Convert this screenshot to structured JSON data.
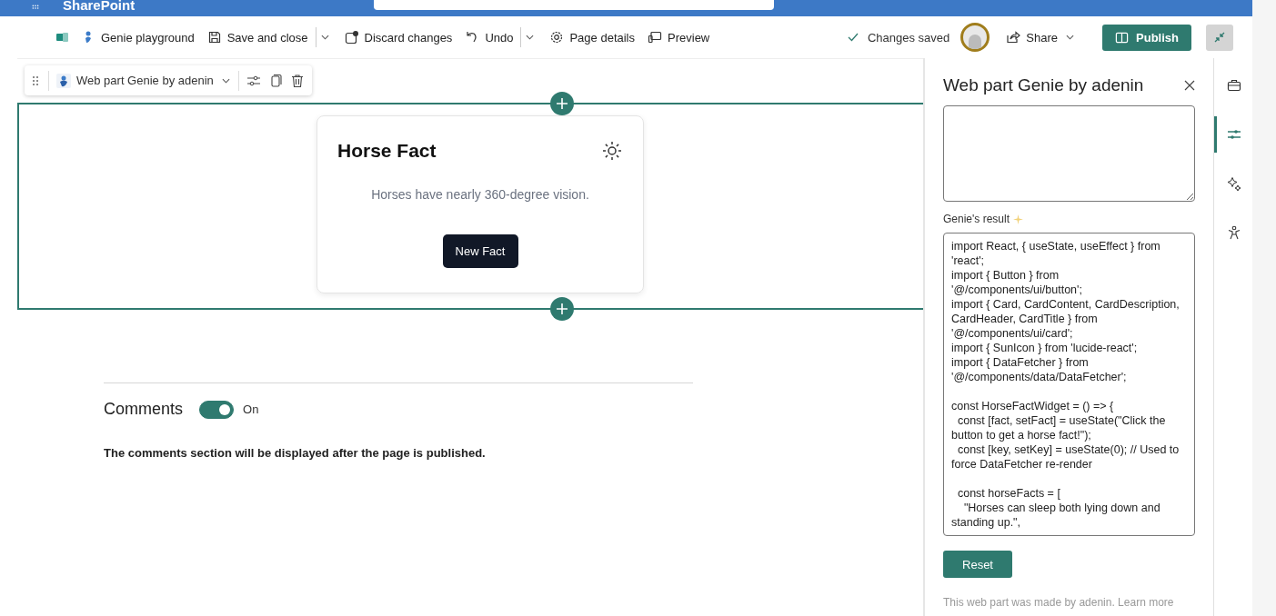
{
  "app_bar": {
    "title": "SharePoint"
  },
  "command_bar": {
    "items": [
      {
        "kind": "site",
        "label": "Genie playground",
        "has_menu": false
      },
      {
        "kind": "save",
        "label": "Save and close",
        "has_menu": true
      },
      {
        "kind": "discard",
        "label": "Discard changes",
        "has_menu": false
      },
      {
        "kind": "undo",
        "label": "Undo",
        "has_menu": true
      },
      {
        "kind": "details",
        "label": "Page details",
        "has_menu": false
      },
      {
        "kind": "preview",
        "label": "Preview",
        "has_menu": false
      }
    ],
    "status": "Changes saved",
    "share": "Share",
    "publish": "Publish"
  },
  "webpart_toolbar": {
    "title": "Web part Genie by adenin"
  },
  "card": {
    "title": "Horse Fact",
    "fact": "Horses have nearly 360-degree vision.",
    "button": "New Fact"
  },
  "comments": {
    "title": "Comments",
    "on": true,
    "state_label": "On",
    "note": "The comments section will be displayed after the page is published."
  },
  "panel": {
    "title": "Web part Genie by adenin",
    "result_label": "Genie's result",
    "code": "import React, { useState, useEffect } from 'react';\nimport { Button } from '@/components/ui/button';\nimport { Card, CardContent, CardDescription, CardHeader, CardTitle } from '@/components/ui/card';\nimport { SunIcon } from 'lucide-react';\nimport { DataFetcher } from '@/components/data/DataFetcher';\n\nconst HorseFactWidget = () => {\n  const [fact, setFact] = useState(\"Click the button to get a horse fact!\");\n  const [key, setKey] = useState(0); // Used to force DataFetcher re-render\n\n  const horseFacts = [\n    \"Horses can sleep both lying down and standing up.\",",
    "reset": "Reset",
    "footer": "This web part was made by adenin.",
    "footer_link": "Learn more"
  },
  "rail": [
    {
      "kind": "toolbox",
      "selected": false
    },
    {
      "kind": "settings",
      "selected": true
    },
    {
      "kind": "sparkle",
      "selected": false
    },
    {
      "kind": "accessibility",
      "selected": false
    }
  ]
}
